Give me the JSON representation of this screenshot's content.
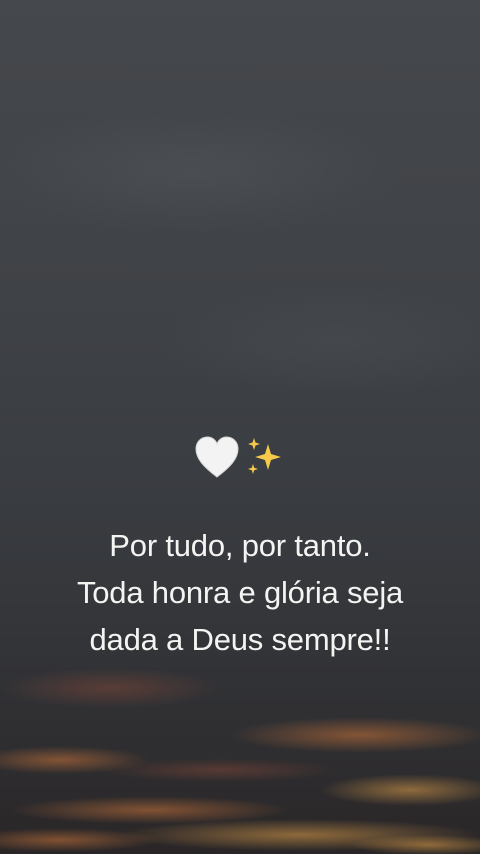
{
  "background": {
    "description_colors": {
      "sky_top": "#45484c",
      "sky_bottom": "#2a2627",
      "cloud_glow": "#c9743a"
    }
  },
  "emojis": [
    {
      "name": "white-heart-icon",
      "glyph": "🤍"
    },
    {
      "name": "sparkles-icon",
      "glyph": "✨"
    }
  ],
  "quote": {
    "line1": "Por tudo, por tanto.",
    "line2": "Toda honra e glória seja",
    "line3": "dada a Deus sempre!!"
  }
}
